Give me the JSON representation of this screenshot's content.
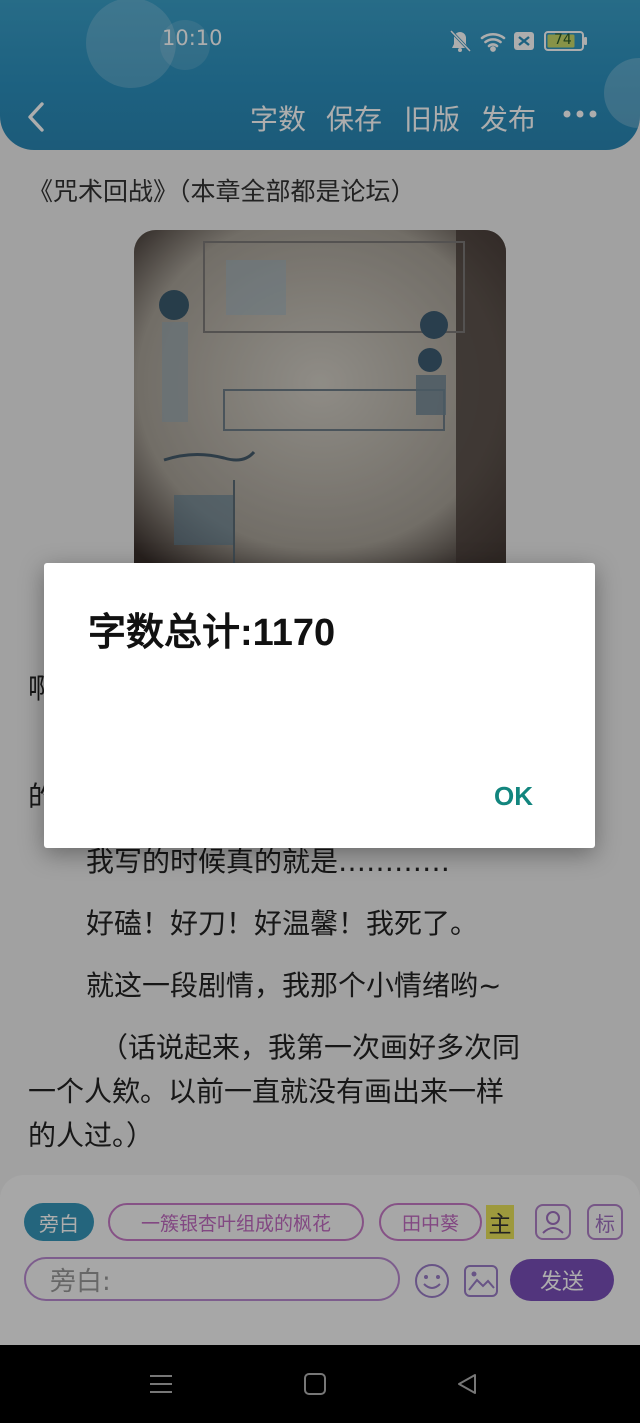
{
  "status_bar": {
    "time": "10:10",
    "battery": "74"
  },
  "header": {
    "buttons": [
      "字数",
      "保存",
      "旧版",
      "发布"
    ]
  },
  "content": {
    "chapter_title": "《咒术回战》（本章全部都是论坛）",
    "hidden_line_1_start": "啊",
    "hidden_line_2_start": "的",
    "paragraphs": [
      "我写的时候真的就是…………",
      "好磕！好刀！好温馨！我死了。",
      "就这一段剧情，我那个小情绪哟~",
      "（话说起来，我第一次画好多次同",
      "一个人欸。以前一直就没有画出来一样",
      "的人过。）"
    ]
  },
  "dialog": {
    "title": "字数总计:1170",
    "ok_label": "OK"
  },
  "composer": {
    "chips": [
      "旁白",
      "一簇银杏叶组成的枫花",
      "田中葵",
      "主"
    ],
    "label_tool": "标",
    "input_placeholder": "旁白:",
    "send_label": "发送"
  },
  "colors": {
    "header": "#2b8fbd",
    "accent_purple": "#7a4fb8",
    "ok_teal": "#12857e"
  }
}
